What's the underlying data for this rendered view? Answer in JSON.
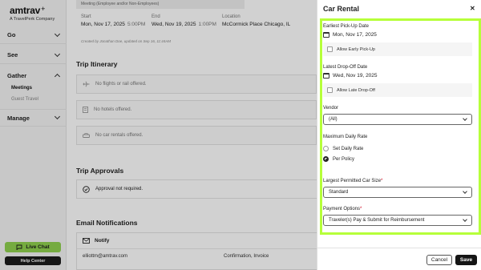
{
  "sidebar": {
    "logo": {
      "name": "amtrav",
      "tagline": "A TravelPerk Company"
    },
    "nav": [
      {
        "label": "Go"
      },
      {
        "label": "See"
      },
      {
        "label": "Gather"
      },
      {
        "label": "Manage"
      }
    ],
    "gather_sub": [
      {
        "label": "Meetings"
      },
      {
        "label": "Guest Travel"
      }
    ],
    "live_chat": "Live Chat",
    "help_center": "Help Center"
  },
  "main": {
    "meeting_type": "Meeting (Employee and/or Non-Employees)",
    "start_label": "Start",
    "start_date": "Mon, Nov 17, 2025",
    "start_time": "5:00PM",
    "end_label": "End",
    "end_date": "Wed, Nov 19, 2025",
    "end_time": "1:00PM",
    "location_label": "Location",
    "location_value": "McCormick Place Chicago, IL",
    "created_by": "Created by Jonathan Doe, updated on Sep 16, 11:44AM",
    "itinerary_title": "Trip Itinerary",
    "no_flights": "No flights or rail offered.",
    "no_hotels": "No hotels offered.",
    "no_cars": "No car rentals offered.",
    "approvals_title": "Trip Approvals",
    "approval_status": "Approval not required.",
    "notifications_title": "Email Notifications",
    "notify_label": "Notify",
    "notify_email": "elliottm@amtrav.com",
    "notify_types": "Confirmation, Invoice"
  },
  "panel": {
    "title": "Car Rental",
    "pickup_label": "Earliest Pick-Up Date",
    "pickup_date": "Mon, Nov 17, 2025",
    "early_pickup_label": "Allow Early Pick-Up",
    "dropoff_label": "Latest Drop-Off Date",
    "dropoff_date": "Wed, Nov 19, 2025",
    "late_dropoff_label": "Allow Late Drop-Off",
    "vendor_label": "Vendor",
    "vendor_value": "(All)",
    "rate_label": "Maximum Daily Rate",
    "rate_option_1": "Set Daily Rate",
    "rate_option_2": "Per Policy",
    "rate_selected": "Per Policy",
    "car_size_label": "Largest Permitted Car Size",
    "car_size_value": "Standard",
    "payment_label": "Payment Options",
    "payment_value": "Traveler(s) Pay & Submit for Reimbursement",
    "cancel": "Cancel",
    "save": "Save"
  },
  "colors": {
    "accent_green": "#8fd14f",
    "highlight_frame": "#b6ff3a",
    "required": "#d0021b",
    "dark": "#151515"
  }
}
